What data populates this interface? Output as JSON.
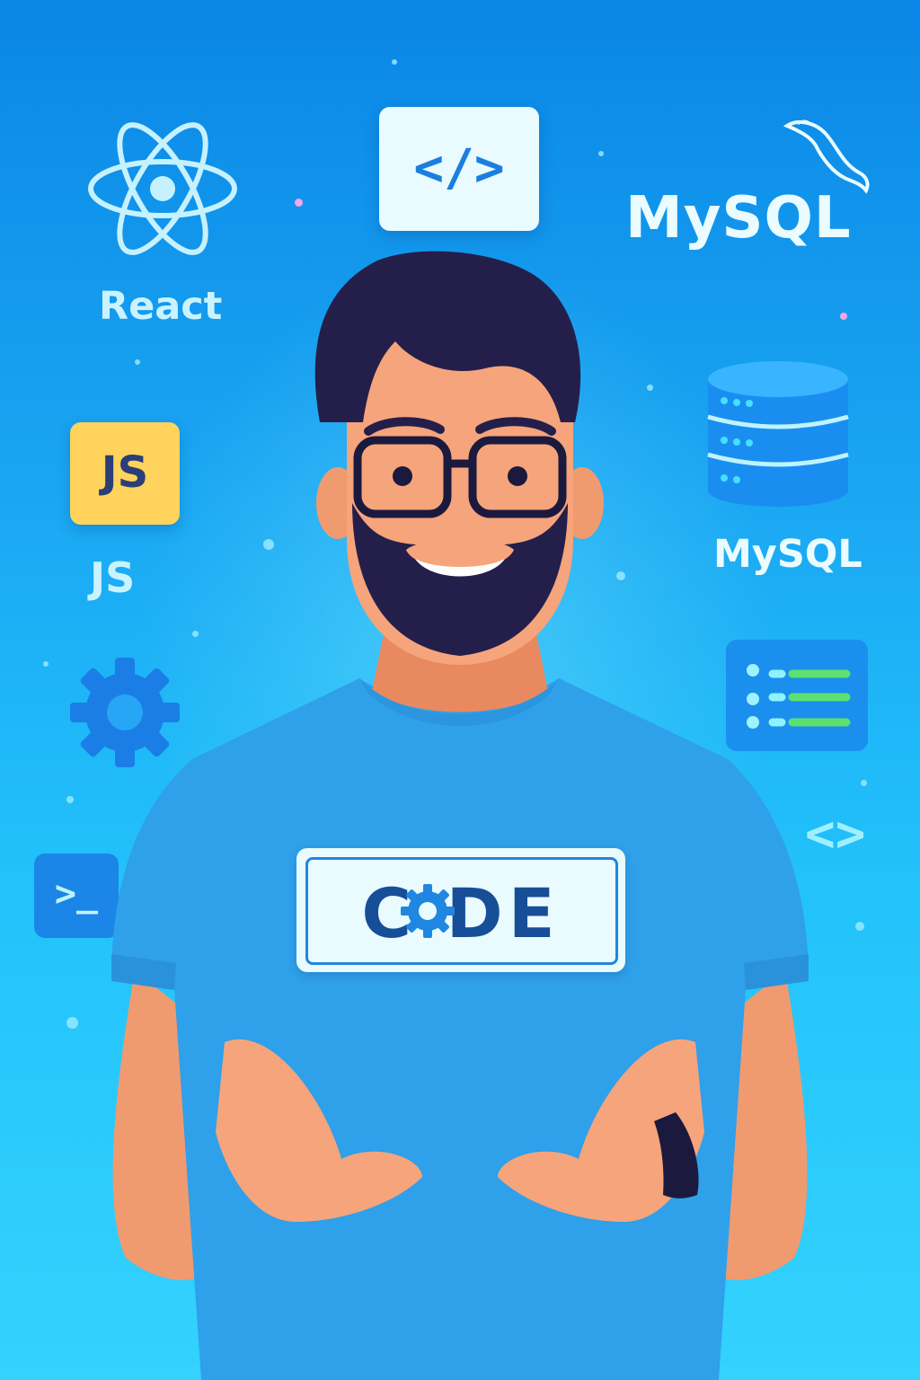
{
  "icons": {
    "react": {
      "label": "React"
    },
    "code_tag": {
      "glyph": "</>"
    },
    "mysql_logo": {
      "wordmark": "MySQL"
    },
    "js_badge": {
      "badge_text": "JS",
      "label": "JS"
    },
    "database": {
      "label": "MySQL"
    },
    "terminal": {
      "glyph": ">_"
    },
    "angle_brackets": {
      "glyph": "<>"
    }
  },
  "shirt": {
    "print_text": "C DE"
  },
  "colors": {
    "background_top": "#0a86e6",
    "background_bottom": "#34d2fd",
    "shirt": "#2fa0ea",
    "skin": "#f09a70",
    "hair": "#241f4a",
    "js_badge": "#ffd35c",
    "code_text": "#174e98"
  }
}
